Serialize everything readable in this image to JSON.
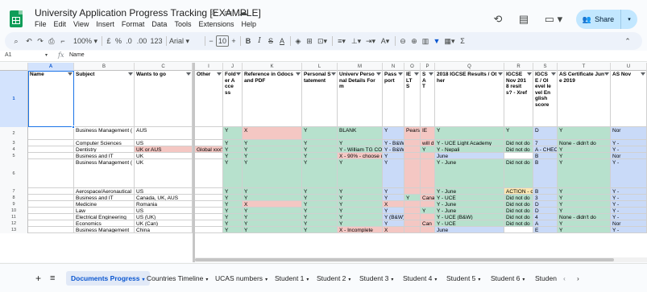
{
  "header": {
    "title": "University Application Progress Tracking [EXAMPLE]",
    "menu": [
      "File",
      "Edit",
      "View",
      "Insert",
      "Format",
      "Data",
      "Tools",
      "Extensions",
      "Help"
    ],
    "share_label": "Share"
  },
  "toolbar": {
    "zoom": "100%",
    "currency": "£",
    "percent": "%",
    "dec_less": ".0",
    "dec_more": ".00",
    "format_123": "123",
    "font": "Arial",
    "font_size": "10",
    "minus": "−",
    "plus": "+",
    "bold": "B",
    "italic": "I",
    "strike": "S",
    "text_color": "A"
  },
  "formula_bar": {
    "cell_ref": "A1",
    "value": "Name"
  },
  "columns": [
    "A",
    "B",
    "C",
    "I",
    "J",
    "K",
    "L",
    "M",
    "N",
    "O",
    "P",
    "Q",
    "R",
    "S",
    "T",
    "U"
  ],
  "headers": {
    "name": "Name",
    "subject": "Subject",
    "wants": "Wants to go",
    "other": "Other",
    "folder": "Folder Access",
    "reference": "Reference in Gdocs and PDF",
    "personal": "Personal Statement",
    "univ": "Univerv Personal Details Form",
    "passport": "Passport",
    "ielts": "IE LT S",
    "sat": "S A T",
    "igcse_other": "2018 IGCSE Results / Other",
    "igcse_nov": "IGCSE Nov 2018 resits? - Xref",
    "igcse_e": "IGCSE / Olevel level English score",
    "as_cert": "AS Certificate June 2019",
    "as_nov": "AS Nov"
  },
  "row_numbers": [
    "1",
    "2",
    "3",
    "4",
    "5",
    "6",
    "7",
    "8",
    "9",
    "10",
    "11",
    "12",
    "13"
  ],
  "rows": [
    {
      "subject": "Business Management (",
      "wants": "AUS",
      "other": "",
      "j": "Y",
      "k": "X",
      "l": "Y",
      "m": "BLANK",
      "n": "Y",
      "o": "Pearson",
      "p": "IE",
      "q": "Y",
      "r": "Y",
      "s": "D",
      "t": "Y",
      "u": "Nor"
    },
    {
      "subject": "Computer Sciences",
      "wants": "US",
      "other": "",
      "j": "Y",
      "k": "Y",
      "l": "Y",
      "m": "Y",
      "n": "Y - B&W",
      "o": "",
      "p": "will d",
      "q": "Y - UCE Light Academy",
      "r": "Did not do",
      "s": "7",
      "t": "None - didn't do",
      "u": "Y -"
    },
    {
      "subject": "Dentistry",
      "wants": "UK or AUS",
      "other": "Global xxx?",
      "j": "Y",
      "k": "Y",
      "l": "Y",
      "m": "Y - William TG CO",
      "n": "Y - B&W",
      "o": "",
      "p": "Y",
      "q": "Y - Nepali",
      "r": "Did not do",
      "s": "A - CHEC",
      "t": "Y",
      "u": "Y -"
    },
    {
      "subject": "Business and IT",
      "wants": "UK",
      "other": "",
      "j": "Y",
      "k": "Y",
      "l": "Y",
      "m": "X - 90% - choose u",
      "n": "Y",
      "o": "",
      "p": "",
      "q": "June",
      "r": "",
      "s": "B",
      "t": "Y",
      "u": "Nor"
    },
    {
      "subject": "Business Management (",
      "wants": "UK",
      "other": "",
      "j": "Y",
      "k": "Y",
      "l": "Y",
      "m": "Y",
      "n": "Y",
      "o": "",
      "p": "",
      "q": "Y - June",
      "r": "Did not do",
      "s": "B",
      "t": "Y",
      "u": "Y -"
    },
    {
      "subject": "Aerospace/Aeronautical",
      "wants": "US",
      "other": "",
      "j": "Y",
      "k": "Y",
      "l": "Y",
      "m": "Y",
      "n": "Y",
      "o": "",
      "p": "",
      "q": "Y - June",
      "r": "ACTION - ch",
      "s": "B",
      "t": "Y",
      "u": "Y -"
    },
    {
      "subject": "Business and IT",
      "wants": "Canada, UK, AUS",
      "other": "",
      "j": "Y",
      "k": "Y",
      "l": "Y",
      "m": "Y",
      "n": "Y",
      "o": "Y",
      "p": "Cana",
      "q": "Y - UCE",
      "r": "Did not do",
      "s": "3",
      "t": "Y",
      "u": "Y -"
    },
    {
      "subject": "Medicine",
      "wants": "Romania",
      "other": "",
      "j": "Y",
      "k": "X",
      "l": "Y",
      "m": "Y",
      "n": "X",
      "o": "",
      "p": "",
      "q": "Y - June",
      "r": "Did not do",
      "s": "D",
      "t": "Y",
      "u": "Y -"
    },
    {
      "subject": "Law",
      "wants": "US",
      "other": "",
      "j": "Y",
      "k": "Y",
      "l": "Y",
      "m": "Y",
      "n": "Y",
      "o": "",
      "p": "Y",
      "q": "Y - June",
      "r": "Did not do",
      "s": "D",
      "t": "Y",
      "u": "Y -"
    },
    {
      "subject": "Electrical Engineering",
      "wants": "US (UK)",
      "other": "",
      "j": "Y",
      "k": "Y",
      "l": "Y",
      "m": "Y",
      "n": "Y (B&W)",
      "o": "",
      "p": "",
      "q": "Y - UCE (B&W)",
      "r": "Did not do",
      "s": "4",
      "t": "None - didn't do",
      "u": "Y -"
    },
    {
      "subject": "Economics",
      "wants": "UK (Can)",
      "other": "",
      "j": "Y",
      "k": "Y",
      "l": "Y",
      "m": "Y",
      "n": "Y",
      "o": "",
      "p": "Can",
      "q": "Y - UCE",
      "r": "Did not do",
      "s": "A",
      "t": "Y",
      "u": "Nor"
    },
    {
      "subject": "Business Management",
      "wants": "China",
      "other": "",
      "j": "Y",
      "k": "Y",
      "l": "Y",
      "m": "X - Incomplete",
      "n": "X",
      "o": "",
      "p": "",
      "q": "June",
      "r": "",
      "s": "E",
      "t": "Y",
      "u": "Y -"
    }
  ],
  "sheet_tabs": [
    "Documents Progress",
    "Countries Timeline",
    "UCAS numbers",
    "Student 1",
    "Student 2",
    "Student 3",
    "Student 4",
    "Student 5",
    "Student 6",
    "Studen"
  ],
  "colors": {
    "green": "#b7e1cd",
    "red": "#f4c7c3",
    "blue": "#c9daf8",
    "yellow": "#fce8b2",
    "accent": "#0b57d0"
  }
}
